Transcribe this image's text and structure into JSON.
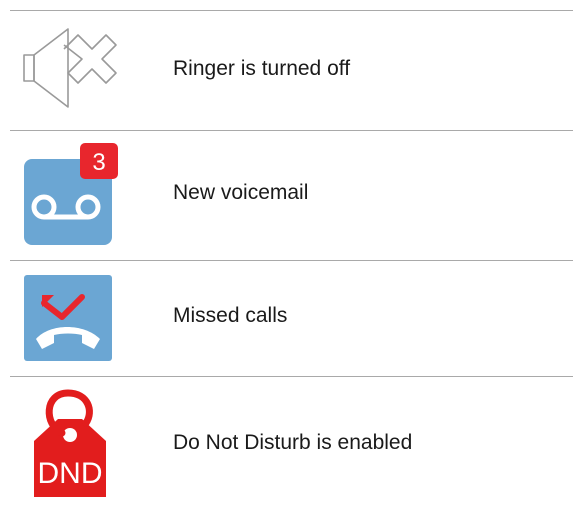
{
  "rows": [
    {
      "icon": "speaker-muted-icon",
      "label": "Ringer is turned off"
    },
    {
      "icon": "voicemail-icon",
      "label": "New voicemail",
      "badge": "3"
    },
    {
      "icon": "missed-call-icon",
      "label": "Missed calls"
    },
    {
      "icon": "dnd-tag-icon",
      "label": "Do Not Disturb is enabled",
      "icon_text": "DND"
    }
  ],
  "colors": {
    "tile_blue": "#6ba6d3",
    "badge_red": "#e8262d",
    "dnd_red": "#e21d1d",
    "outline_gray": "#9a9a9a",
    "divider": "#a9a9a9"
  }
}
